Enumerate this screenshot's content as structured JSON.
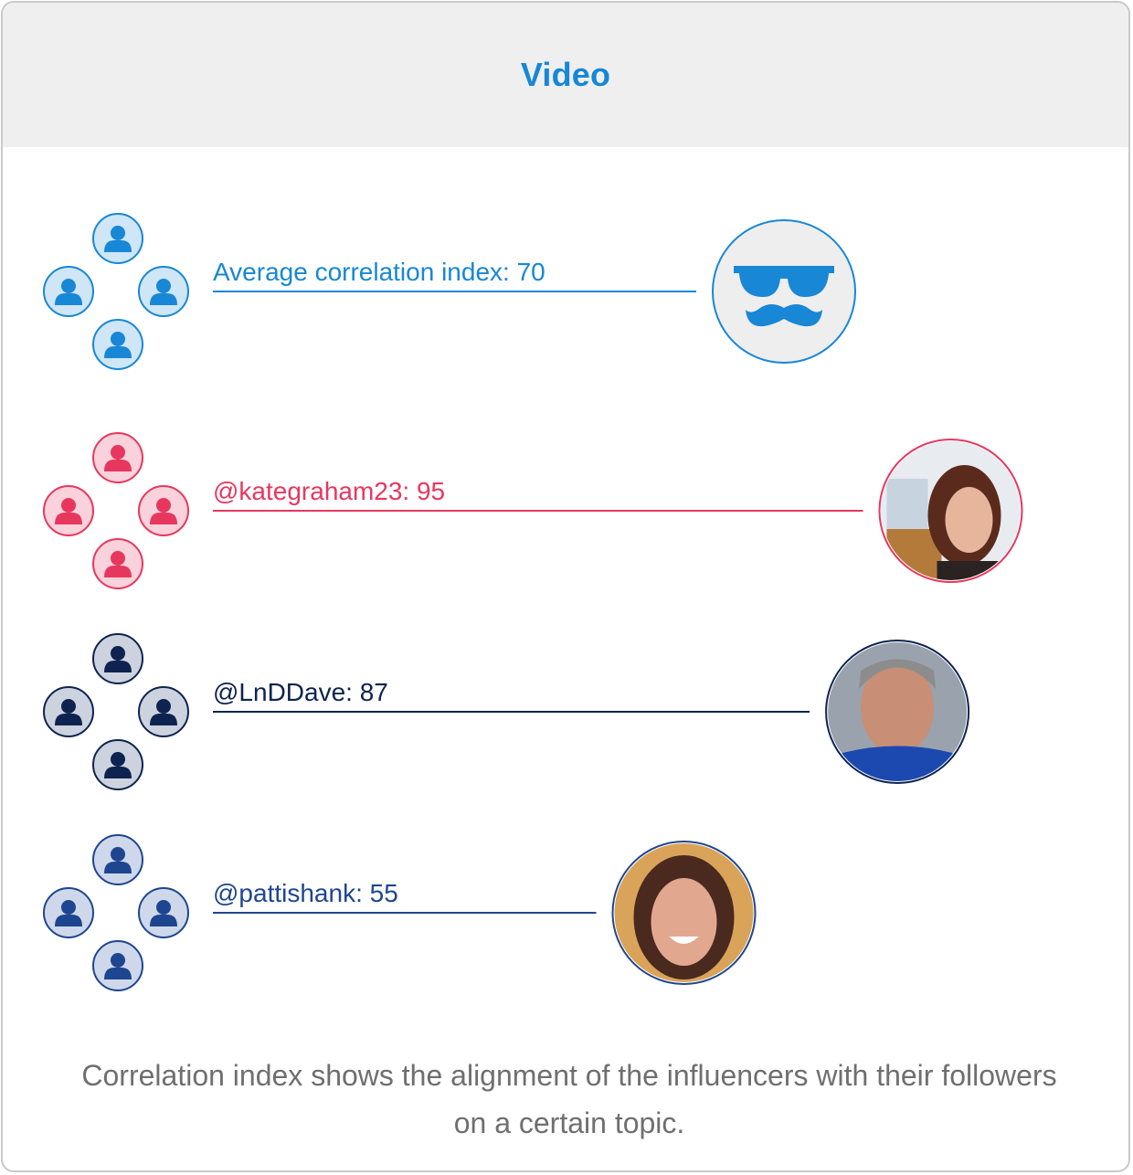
{
  "header": {
    "title": "Video"
  },
  "chart_data": {
    "type": "bar",
    "title": "Video",
    "categories": [
      "Average correlation index",
      "@kategraham23",
      "@LnDDave",
      "@pattishank"
    ],
    "values": [
      70,
      95,
      87,
      55
    ],
    "labels": [
      "Average correlation index: 70",
      "@kategraham23: 95",
      "@LnDDave: 87",
      "@pattishank: 55"
    ],
    "colors": [
      "#1787d6",
      "#e8375f",
      "#0e2350",
      "#1e4690"
    ],
    "follower_fills": [
      "#cfe6f7",
      "#f9d2db",
      "#cdd3de",
      "#cfd8ea"
    ],
    "avatar_icons": [
      "anonymous-glasses-mustache-icon",
      "photo-woman-dark-hair-icon",
      "photo-man-bald-icon",
      "photo-woman-smiling-icon"
    ],
    "follower_icon": "person-icon"
  },
  "caption": "Correlation index shows the alignment of the influencers with their followers on a certain topic."
}
